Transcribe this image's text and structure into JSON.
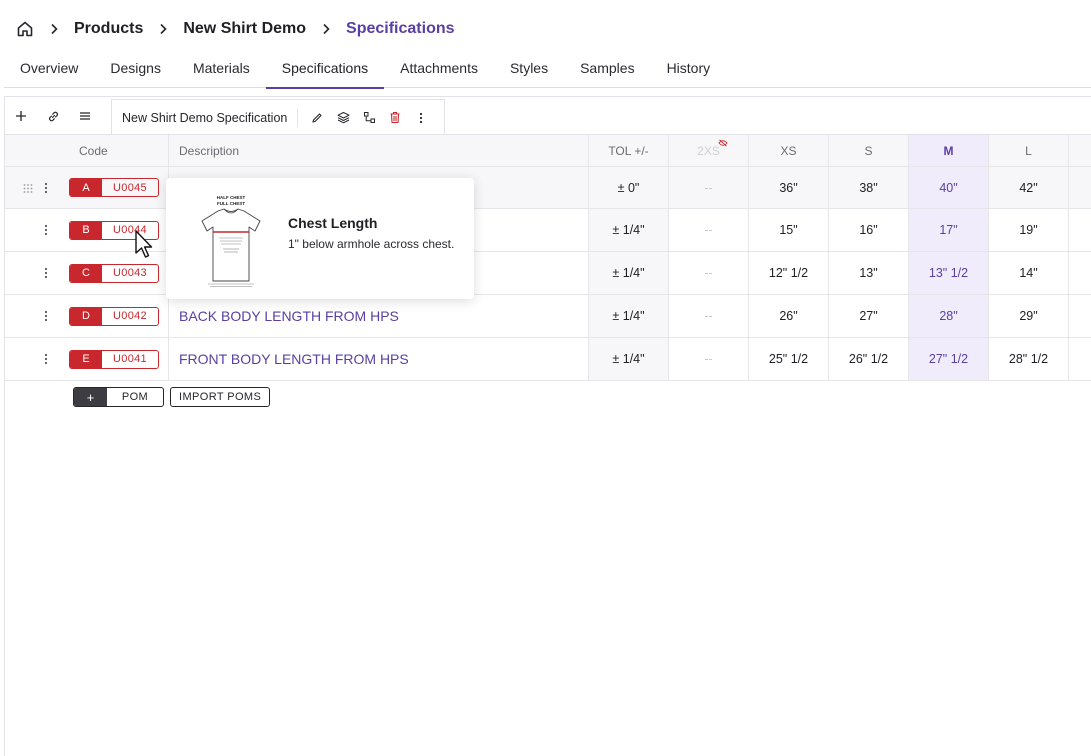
{
  "breadcrumb": {
    "items": [
      "Products",
      "New Shirt Demo",
      "Specifications"
    ]
  },
  "tabs": [
    "Overview",
    "Designs",
    "Materials",
    "Specifications",
    "Attachments",
    "Styles",
    "Samples",
    "History"
  ],
  "active_tab": "Specifications",
  "spec_tab": {
    "name": "New Shirt Demo Specification"
  },
  "grid": {
    "headers": {
      "code": "Code",
      "description": "Description",
      "tol": "TOL +/-",
      "sizes": [
        "2XS",
        "XS",
        "S",
        "M",
        "L"
      ]
    },
    "rows": [
      {
        "letter": "A",
        "code": "U0045",
        "description": "",
        "tol": "± 0\"",
        "values": [
          "--",
          "36\"",
          "38\"",
          "40\"",
          "42\""
        ]
      },
      {
        "letter": "B",
        "code": "U0044",
        "description": "",
        "tol": "± 1/4\"",
        "values": [
          "--",
          "15\"",
          "16\"",
          "17\"",
          "19\""
        ]
      },
      {
        "letter": "C",
        "code": "U0043",
        "description": "",
        "tol": "± 1/4\"",
        "values": [
          "--",
          "12\" 1/2",
          "13\"",
          "13\" 1/2",
          "14\""
        ]
      },
      {
        "letter": "D",
        "code": "U0042",
        "description": "BACK BODY LENGTH FROM HPS",
        "tol": "± 1/4\"",
        "values": [
          "--",
          "26\"",
          "27\"",
          "28\"",
          "29\""
        ]
      },
      {
        "letter": "E",
        "code": "U0041",
        "description": "FRONT BODY LENGTH FROM HPS",
        "tol": "± 1/4\"",
        "values": [
          "--",
          "25\" 1/2",
          "26\" 1/2",
          "27\" 1/2",
          "28\" 1/2"
        ]
      }
    ]
  },
  "buttons": {
    "add_pom_plus": "+",
    "add_pom_label": "POM",
    "import_poms": "IMPORT POMS"
  },
  "popover": {
    "title": "Chest Length",
    "description": "1\" below armhole across chest.",
    "image_caption_1": "HALF CHEST",
    "image_caption_2": "FULL CHEST"
  },
  "colors": {
    "accent": "#5a3fa3",
    "code_red": "#c8282d",
    "m_column_bg": "#f1ecfb"
  }
}
